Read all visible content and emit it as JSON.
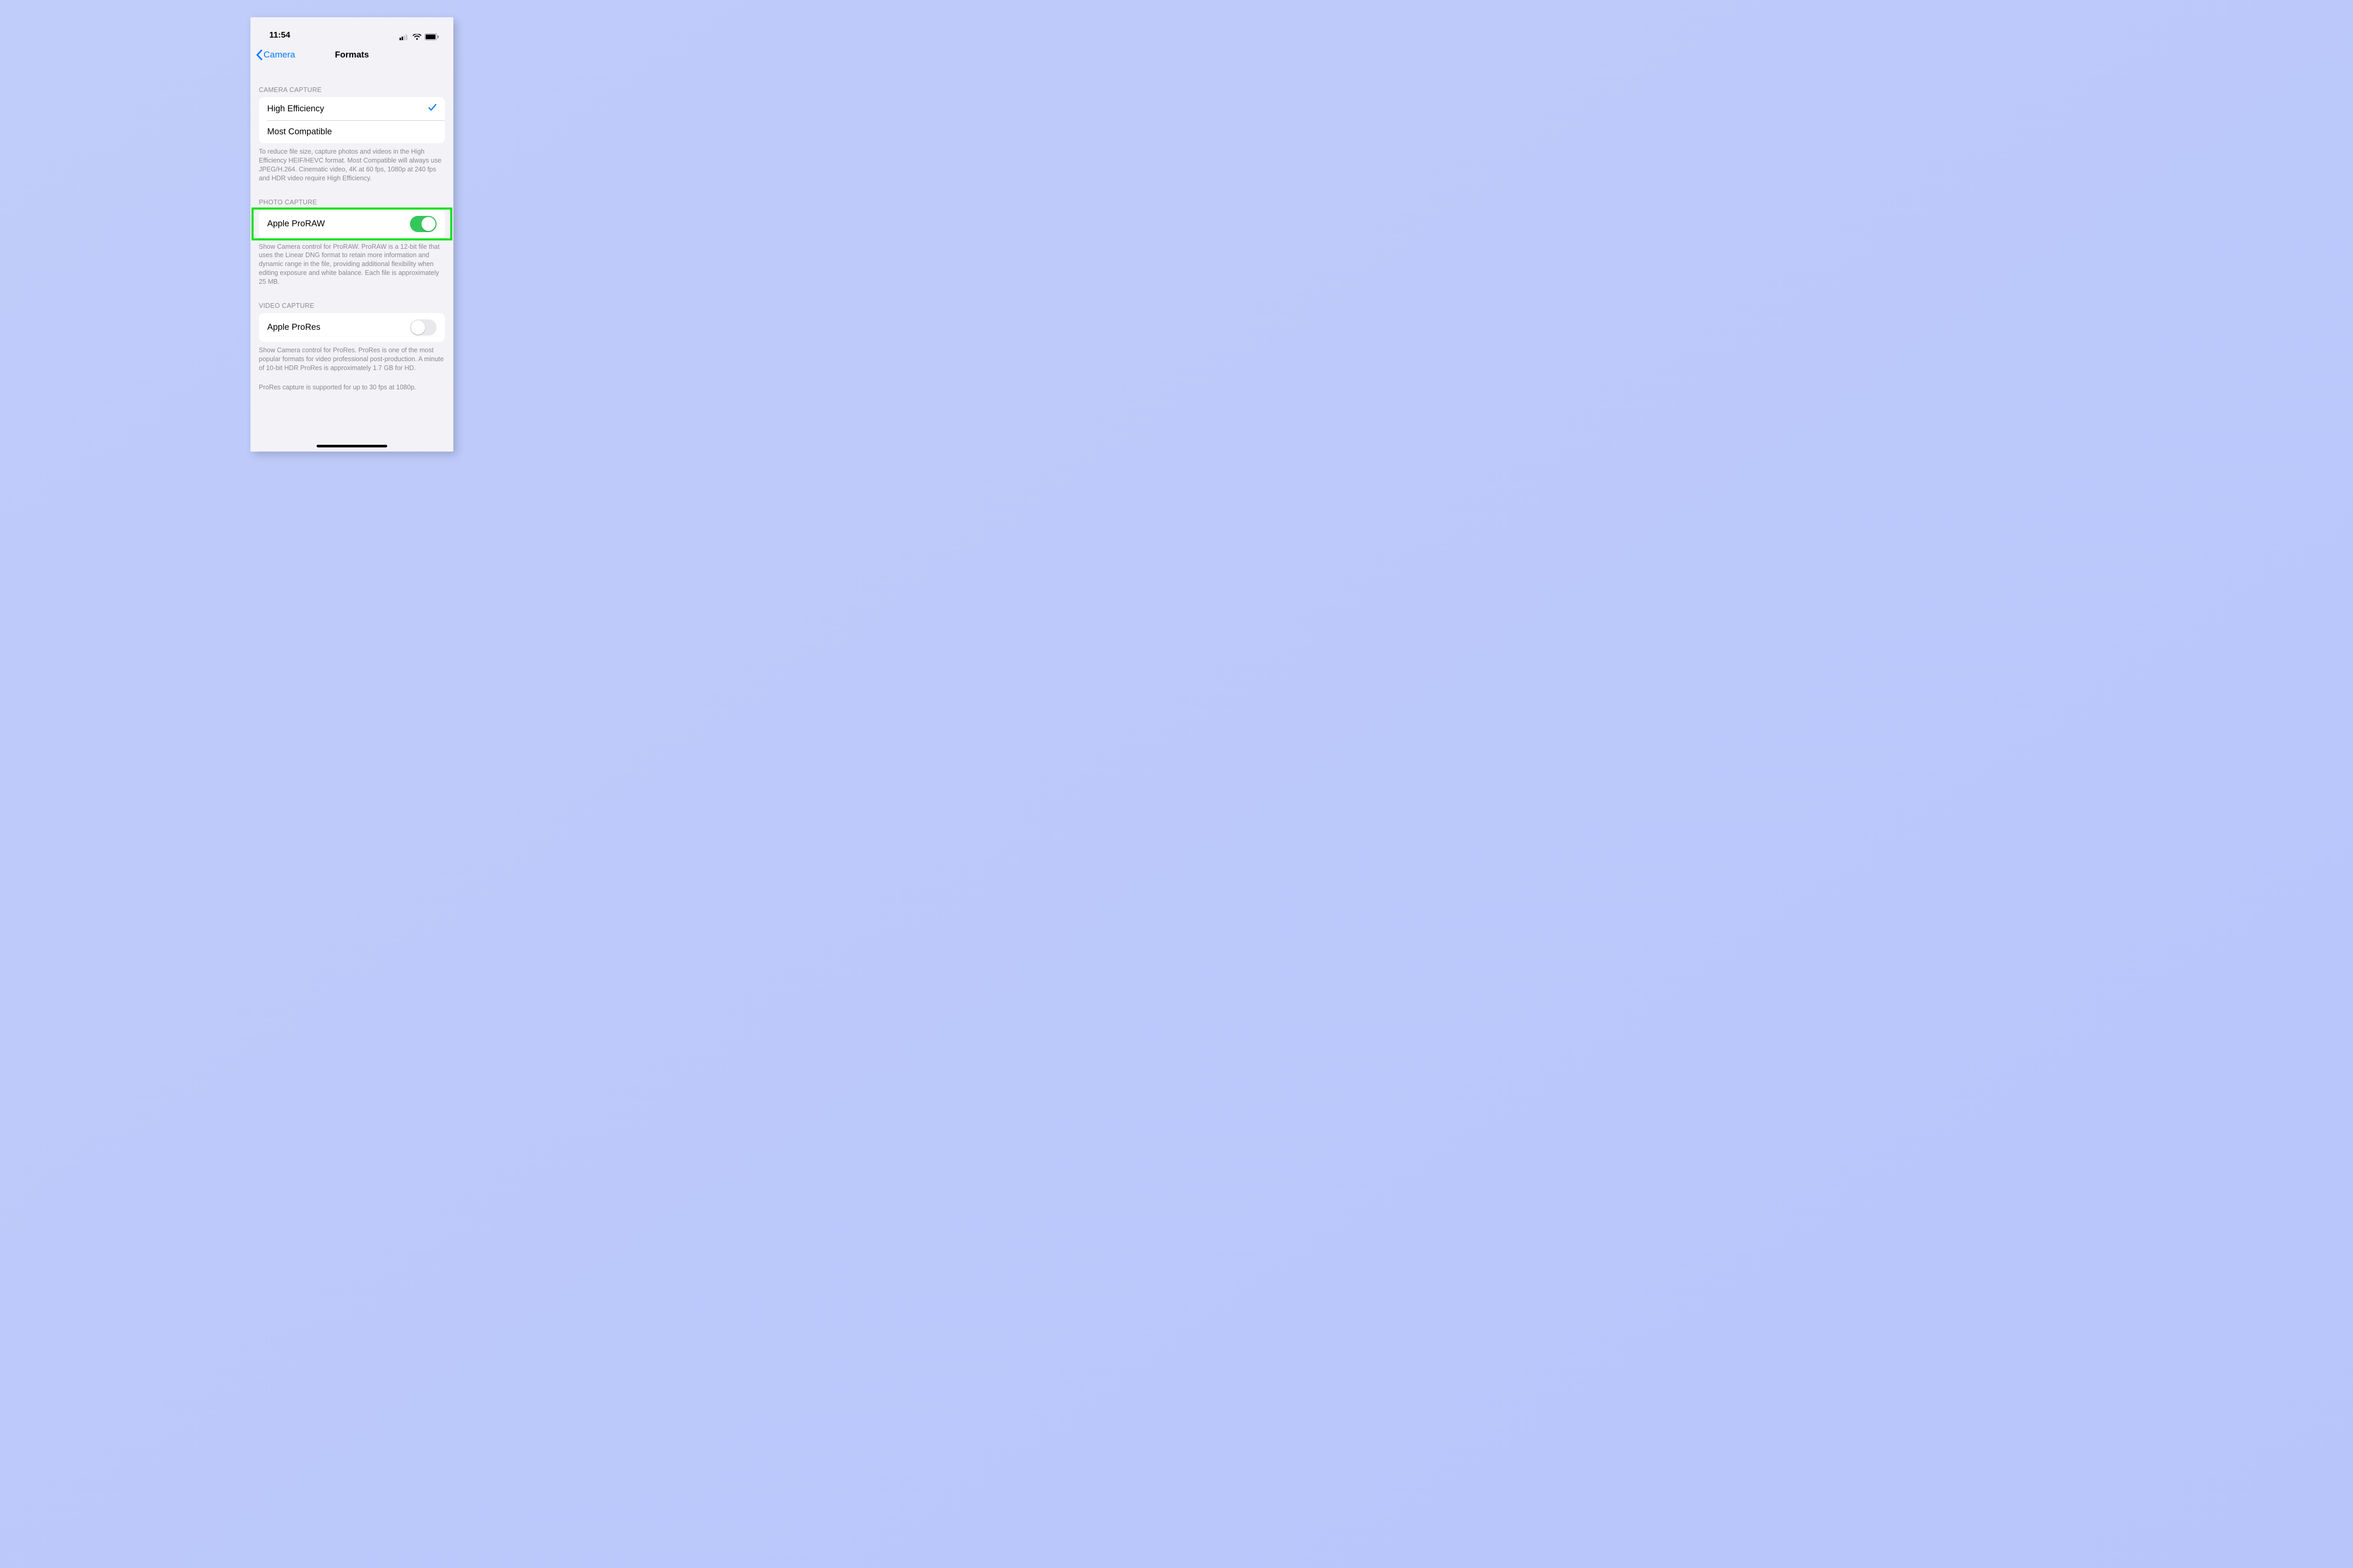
{
  "statusbar": {
    "time": "11:54"
  },
  "nav": {
    "back_label": "Camera",
    "title": "Formats"
  },
  "camera_capture": {
    "header": "CAMERA CAPTURE",
    "options": [
      {
        "label": "High Efficiency",
        "selected": true
      },
      {
        "label": "Most Compatible",
        "selected": false
      }
    ],
    "footer": "To reduce file size, capture photos and videos in the High Efficiency HEIF/HEVC format. Most Compatible will always use JPEG/H.264. Cinematic video, 4K at 60 fps, 1080p at 240 fps and HDR video require High Efficiency."
  },
  "photo_capture": {
    "header": "PHOTO CAPTURE",
    "row_label": "Apple ProRAW",
    "enabled": true,
    "footer": "Show Camera control for ProRAW. ProRAW is a 12-bit file that uses the Linear DNG format to retain more information and dynamic range in the file, providing additional flexibility when editing exposure and white balance. Each file is approximately 25 MB."
  },
  "video_capture": {
    "header": "VIDEO CAPTURE",
    "row_label": "Apple ProRes",
    "enabled": false,
    "footer": "Show Camera control for ProRes. ProRes is one of the most popular formats for video professional post-production. A minute of 10-bit HDR ProRes is approximately 1.7 GB for HD.",
    "footer2": "ProRes capture is supported for up to 30 fps at 1080p."
  },
  "annotation": {
    "highlight_target": "photo_capture_row",
    "color": "#0fe21b"
  }
}
